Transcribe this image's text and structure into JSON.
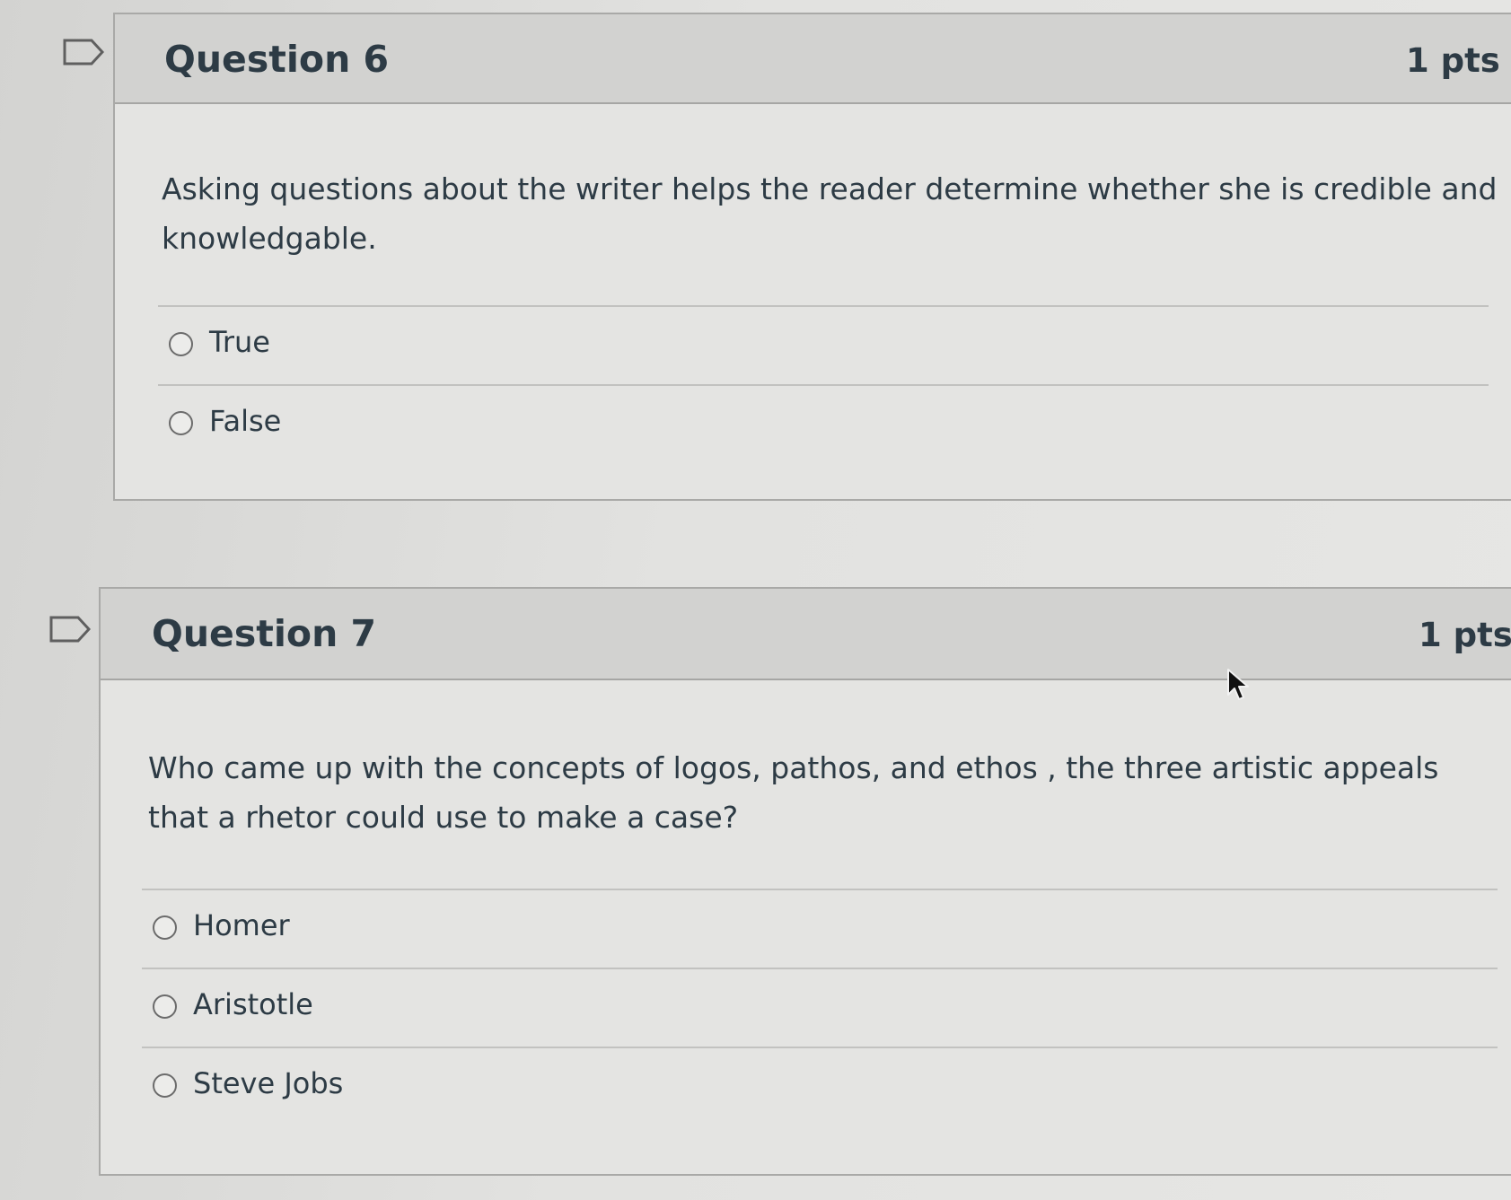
{
  "questions": [
    {
      "title": "Question 6",
      "points": "1 pts",
      "text": "Asking questions about the writer helps the reader determine whether she is credible and knowledgable.",
      "answers": [
        "True",
        "False"
      ]
    },
    {
      "title": "Question 7",
      "points": "1 pts",
      "text": "Who came up with the concepts of logos, pathos, and ethos , the three artistic appeals that a rhetor could use to make a case?",
      "answers": [
        "Homer",
        "Aristotle",
        "Steve Jobs"
      ]
    }
  ],
  "icons": {
    "flag": "flag-question-icon",
    "cursor": "mouse-pointer-icon"
  }
}
